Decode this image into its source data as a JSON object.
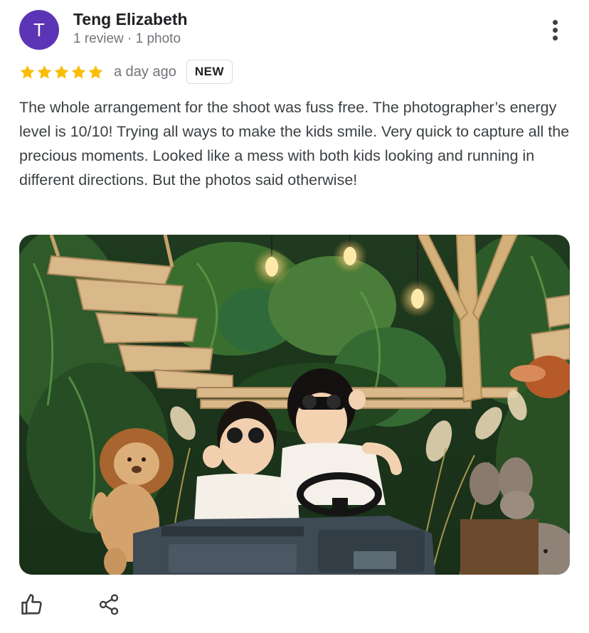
{
  "review": {
    "author": {
      "initial": "T",
      "name": "Teng Elizabeth",
      "meta": "1 review · 1 photo",
      "avatar_color": "#5b35b5"
    },
    "rating": {
      "stars": 5,
      "max_stars": 5,
      "star_color": "#fbbc04",
      "date": "a day ago",
      "badge": "NEW"
    },
    "text": "The whole arrangement for the shoot was fuss free. The photographer’s energy level is 10/10! Trying all ways to make the kids smile. Very quick to capture all the precious moments. Looked like a mess with both kids looking and running in different directions. But the photos said otherwise!",
    "icons": {
      "more": "more-vert-icon",
      "like": "thumbs-up-icon",
      "share": "share-icon"
    }
  }
}
